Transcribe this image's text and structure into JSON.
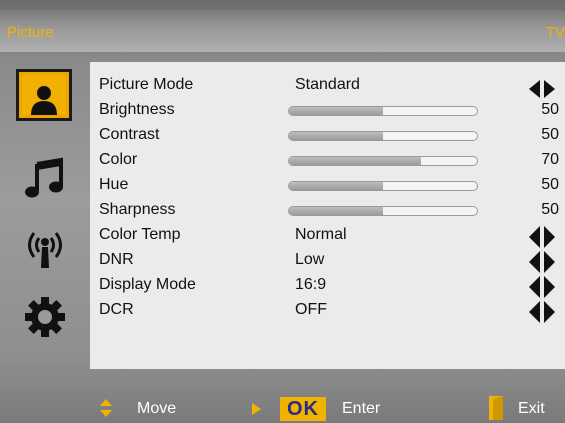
{
  "header": {
    "title_left": "Picture",
    "title_right": "TV"
  },
  "sidebar": {
    "icons": [
      "picture-icon",
      "music-note-icon",
      "antenna-icon",
      "gear-icon"
    ],
    "active_index": 0
  },
  "menu": {
    "items": [
      {
        "label": "Picture Mode",
        "value": "Standard",
        "type": "option"
      },
      {
        "label": "Brightness",
        "value": "50",
        "type": "slider",
        "level": 0.5
      },
      {
        "label": "Contrast",
        "value": "50",
        "type": "slider",
        "level": 0.5
      },
      {
        "label": "Color",
        "value": "70",
        "type": "slider",
        "level": 0.7
      },
      {
        "label": "Hue",
        "value": "50",
        "type": "slider",
        "level": 0.5
      },
      {
        "label": "Sharpness",
        "value": "50",
        "type": "slider",
        "level": 0.5
      },
      {
        "label": "Color Temp",
        "value": "Normal",
        "type": "option"
      },
      {
        "label": "DNR",
        "value": "Low",
        "type": "option"
      },
      {
        "label": "Display Mode",
        "value": "16:9",
        "type": "option"
      },
      {
        "label": "DCR",
        "value": "OFF",
        "type": "option"
      }
    ]
  },
  "footer": {
    "move_label": "Move",
    "ok_label": "OK",
    "enter_label": "Enter",
    "exit_label": "Exit"
  },
  "colors": {
    "accent": "#f0b400",
    "panel": "#ebebeb",
    "text": "#111111"
  }
}
